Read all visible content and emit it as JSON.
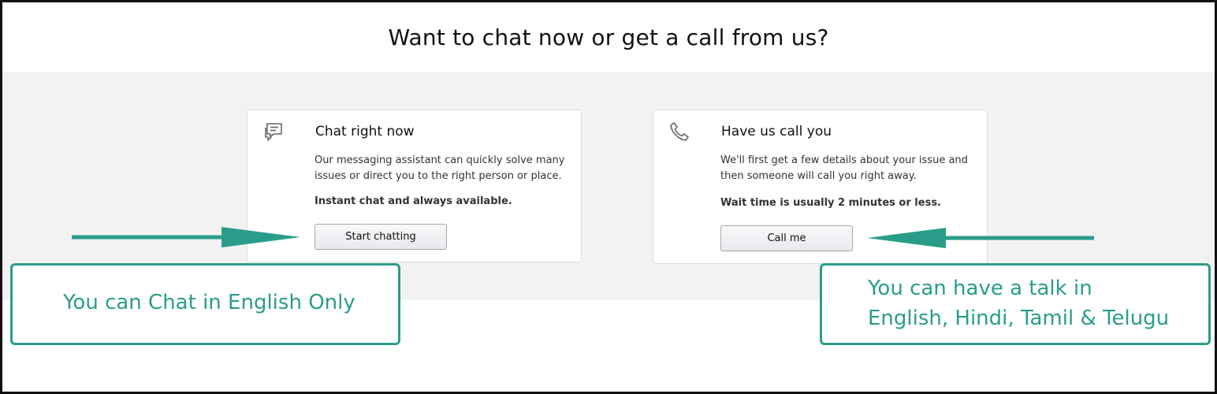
{
  "page": {
    "heading": "Want to chat now or get a call from us?"
  },
  "chat_card": {
    "title": "Chat right now",
    "description": "Our messaging assistant can quickly solve many issues or direct you to the right person or place.",
    "note": "Instant chat and always available.",
    "button_label": "Start chatting",
    "icon": "chat-bubble-icon"
  },
  "call_card": {
    "title": "Have us call you",
    "description": "We'll first get a few details about your issue and then someone will call you right away.",
    "note": "Wait time is usually 2 minutes or less.",
    "button_label": "Call me",
    "icon": "phone-icon"
  },
  "annotations": {
    "left_text": "You can Chat in English Only",
    "right_line1": "You can have a talk in",
    "right_line2": "English, Hindi, Tamil & Telugu",
    "accent_color": "#2a9d8a"
  }
}
